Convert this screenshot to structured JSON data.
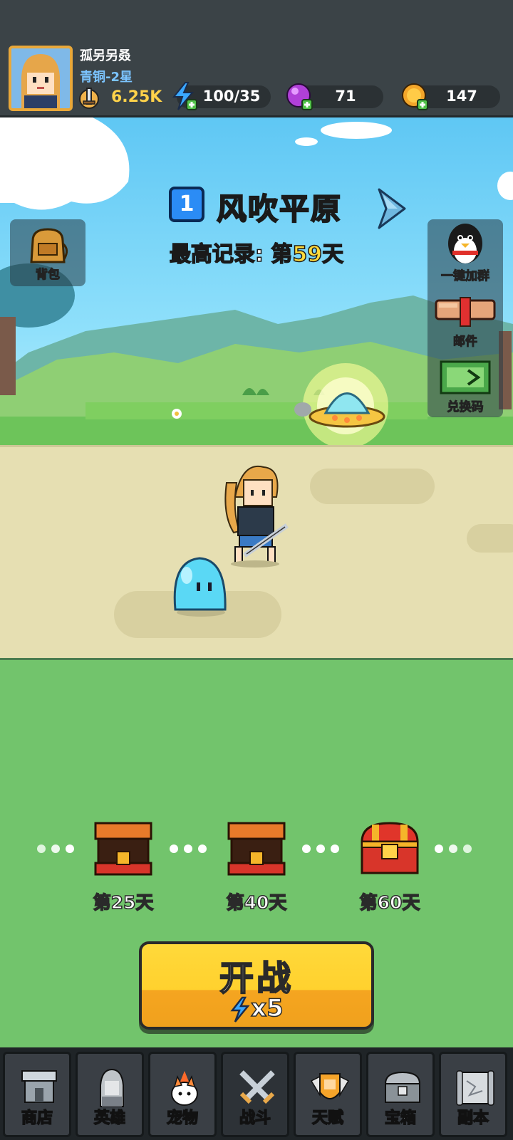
{
  "player": {
    "name": "孤另另叒",
    "rank": "青铜-2星",
    "power": "6.25K"
  },
  "resources": {
    "energy": "100/35",
    "gems": "71",
    "coins": "147"
  },
  "stage": {
    "number": "1",
    "name": "风吹平原",
    "record_prefix": "最高记录: 第",
    "record_day": "59",
    "record_suffix": "天"
  },
  "side_buttons": {
    "bag": "背包",
    "join_group": "一键加群",
    "mail": "邮件",
    "redeem": "兑换码"
  },
  "milestones": [
    {
      "label": "第25天"
    },
    {
      "label": "第40天"
    },
    {
      "label": "第60天"
    }
  ],
  "start": {
    "label": "开战",
    "cost": "x5"
  },
  "nav": [
    {
      "label": "商店",
      "icon": "shop-icon"
    },
    {
      "label": "英雄",
      "icon": "hero-icon"
    },
    {
      "label": "宠物",
      "icon": "pet-icon"
    },
    {
      "label": "战斗",
      "icon": "battle-icon"
    },
    {
      "label": "天赋",
      "icon": "talent-icon"
    },
    {
      "label": "宝箱",
      "icon": "chest-icon"
    },
    {
      "label": "副本",
      "icon": "dungeon-icon"
    }
  ],
  "colors": {
    "hud_bg": "#3b4347",
    "power_text": "#ffd24a",
    "rank_text": "#7bc4ff",
    "record_highlight": "#ffd93b",
    "start_button": "#ffd12e",
    "grass": "#72c46c",
    "road": "#e6dfb2"
  }
}
